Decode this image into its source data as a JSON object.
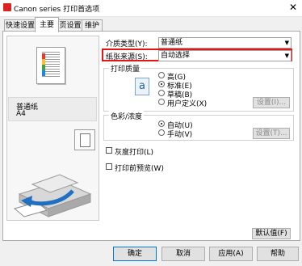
{
  "window": {
    "title": "Canon series 打印首选项",
    "close_glyph": "✕"
  },
  "tabs": [
    {
      "label": "快速设置"
    },
    {
      "label": "主要"
    },
    {
      "label": "页设置"
    },
    {
      "label": "维护"
    }
  ],
  "left_panel": {
    "media_label": "普通纸",
    "size_label": "A4"
  },
  "fields": {
    "media_type_label": "介质类型(Y):",
    "media_type_value": "普通纸",
    "paper_source_label": "纸张来源(S):",
    "paper_source_value": "自动选择"
  },
  "print_quality": {
    "title": "打印质量",
    "options": [
      "高(G)",
      "标准(E)",
      "草稿(B)",
      "用户定义(X)"
    ],
    "selected": "标准(E)",
    "icon_glyph": "a",
    "settings_button": "设置(I)..."
  },
  "color_intensity": {
    "title": "色彩/浓度",
    "options": [
      "自动(U)",
      "手动(V)"
    ],
    "selected": "自动(U)",
    "settings_button": "设置(T)..."
  },
  "checkboxes": {
    "grayscale": "灰度打印(L)",
    "preview": "打印前预览(W)"
  },
  "defaults_button": "默认值(F)",
  "buttons": {
    "ok": "确定",
    "cancel": "取消",
    "apply": "应用(A)",
    "help": "帮助"
  },
  "colors": {
    "highlight": "#e01818",
    "accent": "#0078d7"
  }
}
